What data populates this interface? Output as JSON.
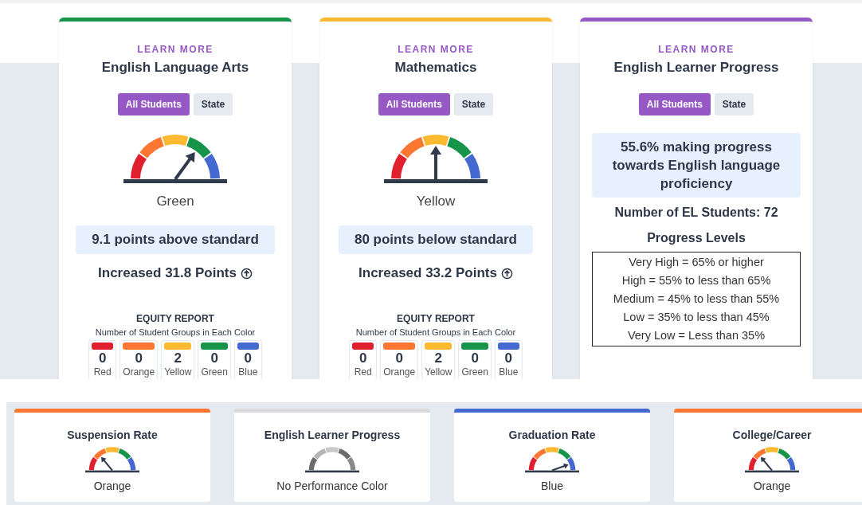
{
  "subjects": [
    {
      "kind": "gauge",
      "color": "#16944a",
      "link": "LEARN MORE",
      "title": "English Language Arts",
      "toggles": [
        {
          "label": "All Students",
          "selected": true
        },
        {
          "label": "State",
          "selected": false
        }
      ],
      "rating_label": "Green",
      "status": "9.1 points above standard",
      "change": "Increased 31.8 Points",
      "equity": {
        "title": "EQUITY REPORT",
        "subtitle": "Number of Student Groups in Each Color",
        "groups": [
          {
            "count": "0",
            "label": "Red",
            "color": "#e0202e"
          },
          {
            "count": "0",
            "label": "Orange",
            "color": "#fd7733"
          },
          {
            "count": "2",
            "label": "Yellow",
            "color": "#fdb92f"
          },
          {
            "count": "0",
            "label": "Green",
            "color": "#16944a"
          },
          {
            "count": "0",
            "label": "Blue",
            "color": "#4469d1"
          }
        ]
      }
    },
    {
      "kind": "gauge",
      "color": "#fdb92f",
      "link": "LEARN MORE",
      "title": "Mathematics",
      "toggles": [
        {
          "label": "All Students",
          "selected": true
        },
        {
          "label": "State",
          "selected": false
        }
      ],
      "rating_label": "Yellow",
      "status": "80 points below standard",
      "change": "Increased 33.2 Points",
      "equity": {
        "title": "EQUITY REPORT",
        "subtitle": "Number of Student Groups in Each Color",
        "groups": [
          {
            "count": "0",
            "label": "Red",
            "color": "#e0202e"
          },
          {
            "count": "0",
            "label": "Orange",
            "color": "#fd7733"
          },
          {
            "count": "2",
            "label": "Yellow",
            "color": "#fdb92f"
          },
          {
            "count": "0",
            "label": "Green",
            "color": "#16944a"
          },
          {
            "count": "0",
            "label": "Blue",
            "color": "#4469d1"
          }
        ]
      }
    },
    {
      "kind": "progress",
      "color": "#9558c4",
      "link": "LEARN MORE",
      "title": "English Learner Progress",
      "toggles": [
        {
          "label": "All Students",
          "selected": true
        },
        {
          "label": "State",
          "selected": false
        }
      ],
      "status": "55.6% making progress towards English language proficiency",
      "count": "Number of EL Students: 72",
      "levels_title": "Progress Levels",
      "levels": [
        "Very High = 65% or higher",
        "High = 55% to less than 65%",
        "Medium = 45% to less than 55%",
        "Low = 35% to less than 45%",
        "Very Low = Less than 35%"
      ]
    }
  ],
  "indicators": [
    {
      "title": "Suspension Rate",
      "rating_label": "Orange",
      "color": "#fd7733"
    },
    {
      "title": "English Learner Progress",
      "rating_label": "No Performance Color",
      "color": "#d9d9d9"
    },
    {
      "title": "Graduation Rate",
      "rating_label": "Blue",
      "color": "#4469d1"
    },
    {
      "title": "College/Career",
      "rating_label": "Orange",
      "color": "#fd7733"
    }
  ]
}
